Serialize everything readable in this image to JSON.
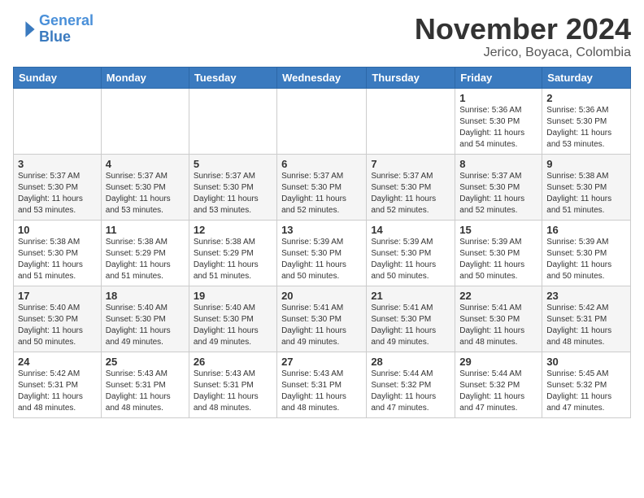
{
  "header": {
    "logo_line1": "General",
    "logo_line2": "Blue",
    "month": "November 2024",
    "location": "Jerico, Boyaca, Colombia"
  },
  "weekdays": [
    "Sunday",
    "Monday",
    "Tuesday",
    "Wednesday",
    "Thursday",
    "Friday",
    "Saturday"
  ],
  "weeks": [
    [
      {
        "day": "",
        "info": ""
      },
      {
        "day": "",
        "info": ""
      },
      {
        "day": "",
        "info": ""
      },
      {
        "day": "",
        "info": ""
      },
      {
        "day": "",
        "info": ""
      },
      {
        "day": "1",
        "info": "Sunrise: 5:36 AM\nSunset: 5:30 PM\nDaylight: 11 hours\nand 54 minutes."
      },
      {
        "day": "2",
        "info": "Sunrise: 5:36 AM\nSunset: 5:30 PM\nDaylight: 11 hours\nand 53 minutes."
      }
    ],
    [
      {
        "day": "3",
        "info": "Sunrise: 5:37 AM\nSunset: 5:30 PM\nDaylight: 11 hours\nand 53 minutes."
      },
      {
        "day": "4",
        "info": "Sunrise: 5:37 AM\nSunset: 5:30 PM\nDaylight: 11 hours\nand 53 minutes."
      },
      {
        "day": "5",
        "info": "Sunrise: 5:37 AM\nSunset: 5:30 PM\nDaylight: 11 hours\nand 53 minutes."
      },
      {
        "day": "6",
        "info": "Sunrise: 5:37 AM\nSunset: 5:30 PM\nDaylight: 11 hours\nand 52 minutes."
      },
      {
        "day": "7",
        "info": "Sunrise: 5:37 AM\nSunset: 5:30 PM\nDaylight: 11 hours\nand 52 minutes."
      },
      {
        "day": "8",
        "info": "Sunrise: 5:37 AM\nSunset: 5:30 PM\nDaylight: 11 hours\nand 52 minutes."
      },
      {
        "day": "9",
        "info": "Sunrise: 5:38 AM\nSunset: 5:30 PM\nDaylight: 11 hours\nand 51 minutes."
      }
    ],
    [
      {
        "day": "10",
        "info": "Sunrise: 5:38 AM\nSunset: 5:30 PM\nDaylight: 11 hours\nand 51 minutes."
      },
      {
        "day": "11",
        "info": "Sunrise: 5:38 AM\nSunset: 5:29 PM\nDaylight: 11 hours\nand 51 minutes."
      },
      {
        "day": "12",
        "info": "Sunrise: 5:38 AM\nSunset: 5:29 PM\nDaylight: 11 hours\nand 51 minutes."
      },
      {
        "day": "13",
        "info": "Sunrise: 5:39 AM\nSunset: 5:30 PM\nDaylight: 11 hours\nand 50 minutes."
      },
      {
        "day": "14",
        "info": "Sunrise: 5:39 AM\nSunset: 5:30 PM\nDaylight: 11 hours\nand 50 minutes."
      },
      {
        "day": "15",
        "info": "Sunrise: 5:39 AM\nSunset: 5:30 PM\nDaylight: 11 hours\nand 50 minutes."
      },
      {
        "day": "16",
        "info": "Sunrise: 5:39 AM\nSunset: 5:30 PM\nDaylight: 11 hours\nand 50 minutes."
      }
    ],
    [
      {
        "day": "17",
        "info": "Sunrise: 5:40 AM\nSunset: 5:30 PM\nDaylight: 11 hours\nand 50 minutes."
      },
      {
        "day": "18",
        "info": "Sunrise: 5:40 AM\nSunset: 5:30 PM\nDaylight: 11 hours\nand 49 minutes."
      },
      {
        "day": "19",
        "info": "Sunrise: 5:40 AM\nSunset: 5:30 PM\nDaylight: 11 hours\nand 49 minutes."
      },
      {
        "day": "20",
        "info": "Sunrise: 5:41 AM\nSunset: 5:30 PM\nDaylight: 11 hours\nand 49 minutes."
      },
      {
        "day": "21",
        "info": "Sunrise: 5:41 AM\nSunset: 5:30 PM\nDaylight: 11 hours\nand 49 minutes."
      },
      {
        "day": "22",
        "info": "Sunrise: 5:41 AM\nSunset: 5:30 PM\nDaylight: 11 hours\nand 48 minutes."
      },
      {
        "day": "23",
        "info": "Sunrise: 5:42 AM\nSunset: 5:31 PM\nDaylight: 11 hours\nand 48 minutes."
      }
    ],
    [
      {
        "day": "24",
        "info": "Sunrise: 5:42 AM\nSunset: 5:31 PM\nDaylight: 11 hours\nand 48 minutes."
      },
      {
        "day": "25",
        "info": "Sunrise: 5:43 AM\nSunset: 5:31 PM\nDaylight: 11 hours\nand 48 minutes."
      },
      {
        "day": "26",
        "info": "Sunrise: 5:43 AM\nSunset: 5:31 PM\nDaylight: 11 hours\nand 48 minutes."
      },
      {
        "day": "27",
        "info": "Sunrise: 5:43 AM\nSunset: 5:31 PM\nDaylight: 11 hours\nand 48 minutes."
      },
      {
        "day": "28",
        "info": "Sunrise: 5:44 AM\nSunset: 5:32 PM\nDaylight: 11 hours\nand 47 minutes."
      },
      {
        "day": "29",
        "info": "Sunrise: 5:44 AM\nSunset: 5:32 PM\nDaylight: 11 hours\nand 47 minutes."
      },
      {
        "day": "30",
        "info": "Sunrise: 5:45 AM\nSunset: 5:32 PM\nDaylight: 11 hours\nand 47 minutes."
      }
    ]
  ]
}
